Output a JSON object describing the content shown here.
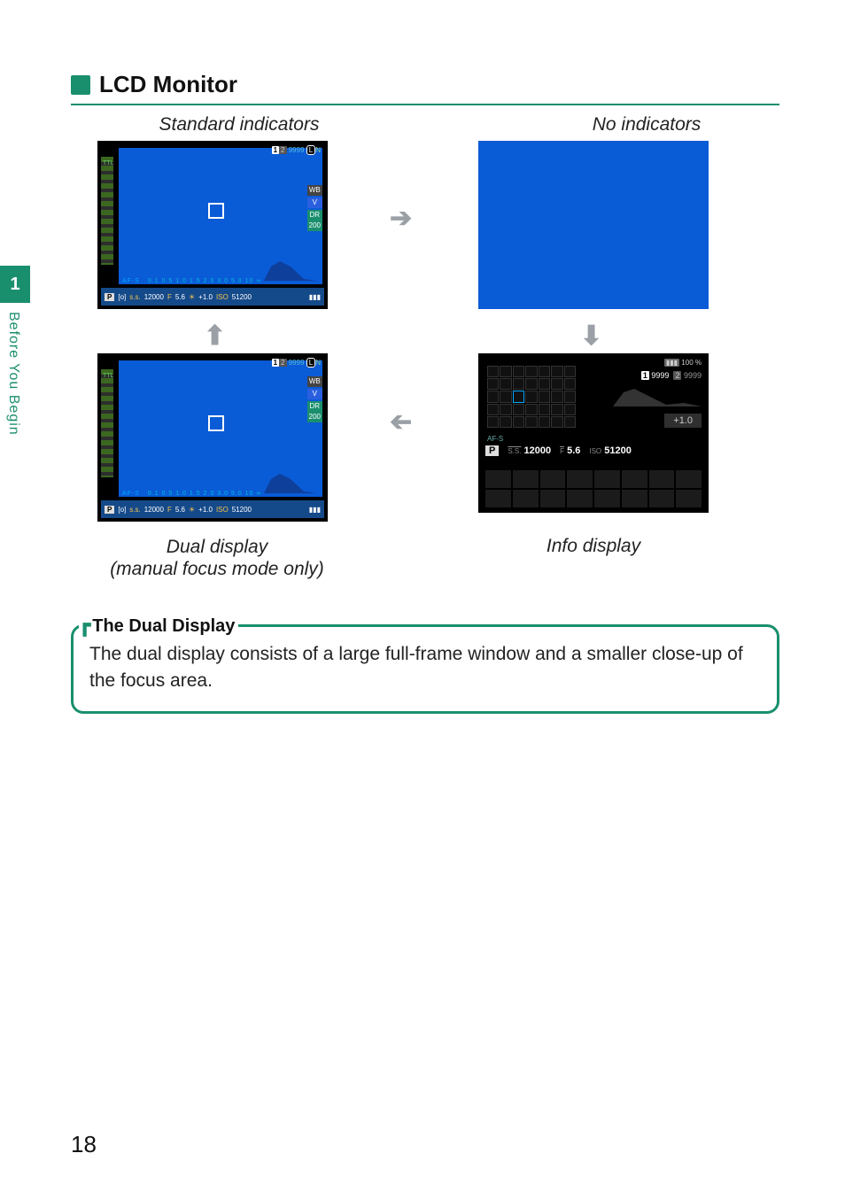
{
  "sidebar": {
    "chapter_number": "1",
    "chapter_label": "Before You Begin"
  },
  "header": {
    "title": "LCD Monitor"
  },
  "captions": {
    "standard": "Standard indicators",
    "no_indicators": "No indicators",
    "dual_line1": "Dual display",
    "dual_line2": "(manual focus mode only)",
    "info": "Info display"
  },
  "std_screen": {
    "slot1_label": "1",
    "slot2_label": "2",
    "frames": "9999",
    "size_badge": "L",
    "quality": "N",
    "ttl": "TTL",
    "wb_icon": "WB",
    "film_sim": "V",
    "dr_label": "DR",
    "dr_value": "200",
    "focus_mode": "AF-S",
    "distance_scale": "0.1 0.5  1.0  1.5  2.0  3.0  5.0  10  ∞",
    "mode": "P",
    "meter_icon": "[o]",
    "ss_label": "s.s.",
    "ss_value": "12000",
    "ap_label": "F",
    "ap_value": "5.6",
    "ev_icon": "☀",
    "ev_value": "+1.0",
    "iso_label": "ISO",
    "iso_value": "51200",
    "battery": "▮▮▮"
  },
  "info_screen": {
    "battery_label": "100",
    "slot1_label": "1",
    "slot1_count": "9999",
    "slot2_label": "2",
    "slot2_count": "9999",
    "focus_mode": "AF-S",
    "ev_value": "+1.0",
    "mode": "P",
    "ss_label": "S.S.",
    "ss_value": "12000",
    "ap_label": "F",
    "ap_value": "5.6",
    "iso_label": "ISO",
    "iso_value": "51200"
  },
  "callout": {
    "title": "The Dual Display",
    "body": "The dual display consists of a large full-frame window and a smaller close-up of the focus area."
  },
  "page_number": "18"
}
